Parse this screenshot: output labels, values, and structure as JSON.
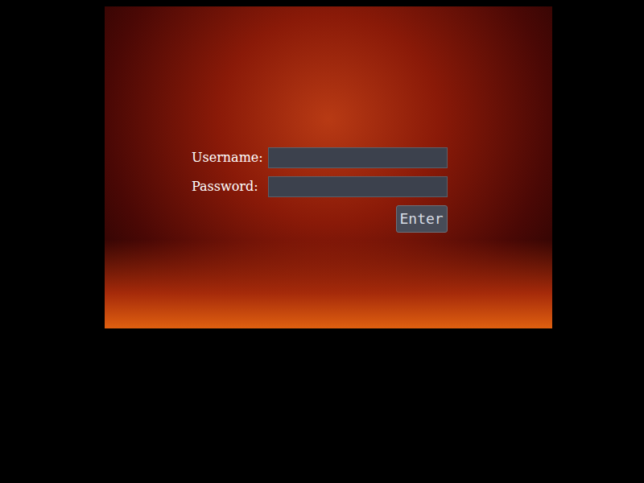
{
  "form": {
    "fields": [
      {
        "label": "Username:"
      },
      {
        "label": "Password:"
      }
    ],
    "submit": "Enter"
  }
}
